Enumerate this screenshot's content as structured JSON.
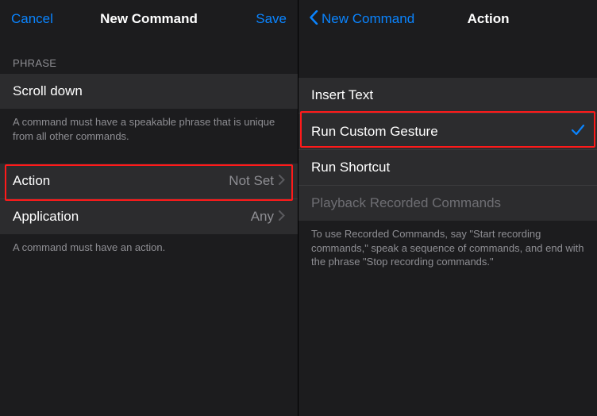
{
  "left": {
    "nav": {
      "cancel": "Cancel",
      "title": "New Command",
      "save": "Save"
    },
    "phrase": {
      "header": "PHRASE",
      "value": "Scroll down",
      "footer": "A command must have a speakable phrase that is unique from all other commands."
    },
    "rows": {
      "action": {
        "label": "Action",
        "value": "Not Set"
      },
      "application": {
        "label": "Application",
        "value": "Any"
      }
    },
    "footer": "A command must have an action."
  },
  "right": {
    "nav": {
      "back": "New Command",
      "title": "Action"
    },
    "options": {
      "insert_text": "Insert Text",
      "run_custom_gesture": "Run Custom Gesture",
      "run_shortcut": "Run Shortcut",
      "playback": "Playback Recorded Commands"
    },
    "footer": "To use Recorded Commands, say \"Start recording commands,\" speak a sequence of commands, and end with the phrase \"Stop recording commands.\""
  }
}
